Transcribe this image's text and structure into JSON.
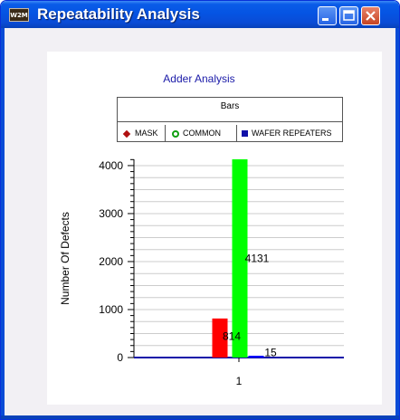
{
  "window": {
    "title": "Repeatability Analysis",
    "app_icon_text": "W2M",
    "buttons": [
      "minimize",
      "maximize",
      "close"
    ]
  },
  "chart_data": {
    "type": "bar",
    "title": "Adder Analysis",
    "legend_title": "Bars",
    "categories": [
      "1"
    ],
    "series": [
      {
        "name": "MASK",
        "values": [
          814
        ],
        "color": "#ff0000",
        "label": "814"
      },
      {
        "name": "COMMON",
        "values": [
          4131
        ],
        "color": "#00ff00",
        "label": "4131"
      },
      {
        "name": "WAFER REPEATERS",
        "values": [
          15
        ],
        "color": "#0000ff",
        "label": "15"
      }
    ],
    "ylabel": "Number Of Defects",
    "xlabel": "",
    "ylim": [
      0,
      4131
    ],
    "yticks": [
      0,
      1000,
      2000,
      3000,
      4000
    ],
    "ytick_labels": [
      "0",
      "1000",
      "2000",
      "3000",
      "4000"
    ],
    "grid": true,
    "legend_position": "top"
  }
}
